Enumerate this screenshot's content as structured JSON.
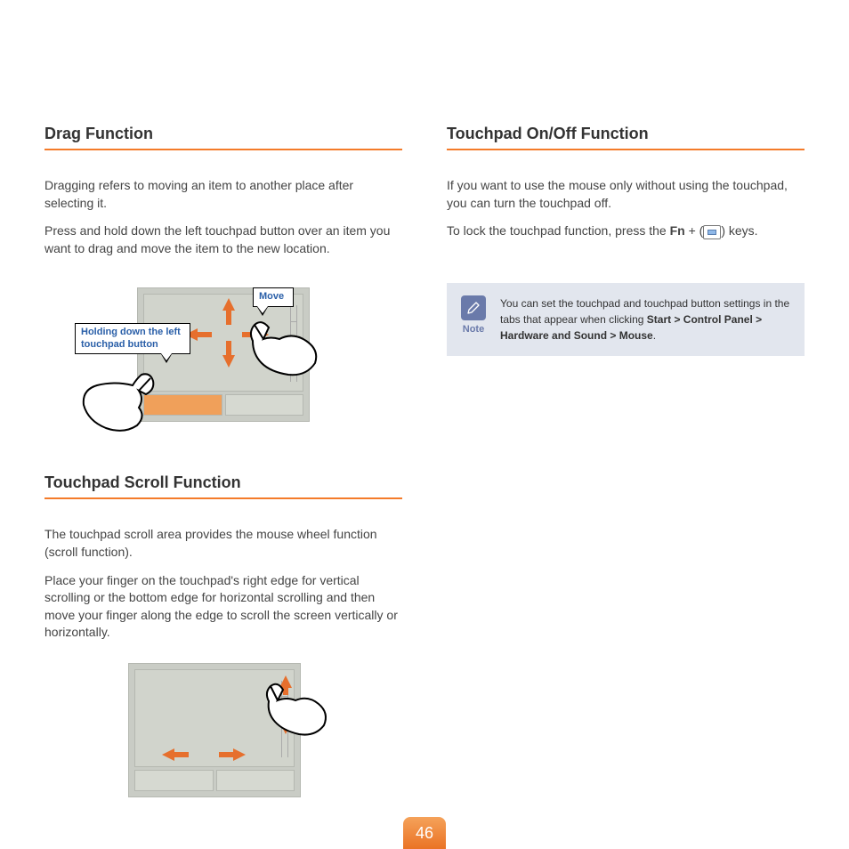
{
  "page_number": "46",
  "left_column": {
    "section1": {
      "heading": "Drag Function",
      "p1": "Dragging refers to moving an item to another place after selecting it.",
      "p2": "Press and hold down the left touchpad button over an item you want to drag and move the item to the new location.",
      "callout_hold": "Holding down the left touchpad button",
      "callout_move": "Move"
    },
    "section2": {
      "heading": "Touchpad Scroll Function",
      "p1": "The touchpad scroll area provides the mouse wheel function (scroll function).",
      "p2": "Place your finger on the touchpad's right edge for vertical scrolling or the bottom edge for horizontal scrolling and then move your finger along the edge to scroll the screen vertically or horizontally."
    }
  },
  "right_column": {
    "section1": {
      "heading": "Touchpad On/Off Function",
      "p1": "If you want to use the mouse only without using the touchpad, you can turn the touchpad off.",
      "p2_prefix": "To lock the touchpad function, press the ",
      "p2_fn": "Fn",
      "p2_plus": " + (",
      "p2_suffix": ") keys."
    },
    "note": {
      "label": "Note",
      "text_prefix": "You can set the touchpad and touchpad button settings in the tabs that appear when clicking ",
      "path": "Start > Control Panel > Hardware and Sound > Mouse",
      "text_suffix": "."
    }
  }
}
